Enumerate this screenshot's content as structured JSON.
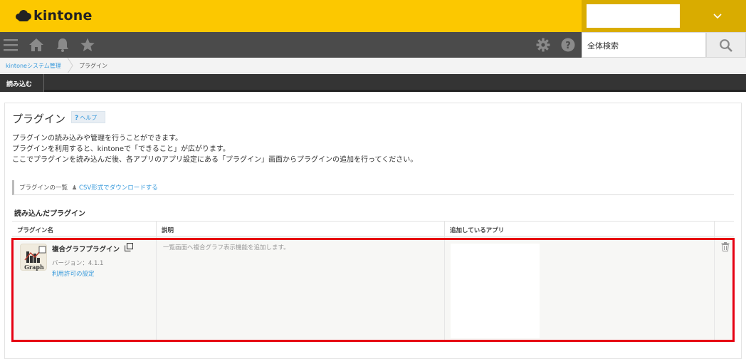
{
  "brand": {
    "name": "kintone"
  },
  "search": {
    "placeholder": "全体検索"
  },
  "breadcrumb": {
    "items": [
      "kintoneシステム管理",
      "プラグイン"
    ]
  },
  "toolbar": {
    "load_label": "読み込む"
  },
  "page": {
    "title": "プラグイン",
    "help_label": "ヘルプ",
    "description": [
      "プラグインの読み込みや管理を行うことができます。",
      "プラグインを利用すると、kintoneで「できること」が広がります。",
      "ここでプラグインを読み込んだ後、各アプリのアプリ設定にある「プラグイン」画面からプラグインの追加を行ってください。"
    ],
    "list_label": "プラグインの一覧",
    "csv_label": "CSV形式でダウンロードする",
    "loaded_title": "読み込んだプラグイン"
  },
  "table": {
    "headers": [
      "プラグイン名",
      "説明",
      "追加しているアプリ"
    ],
    "rows": [
      {
        "name": "複合グラフプラグイン",
        "version": "バージョン：4.1.1",
        "license_link": "利用許可の設定",
        "description": "一覧画面へ複合グラフ表示機能を追加します。",
        "icon_label": "Graph"
      }
    ]
  },
  "colors": {
    "header": "#fcc800",
    "nav": "#4b4b4b",
    "link": "#3498db",
    "highlight": "#e60012"
  }
}
